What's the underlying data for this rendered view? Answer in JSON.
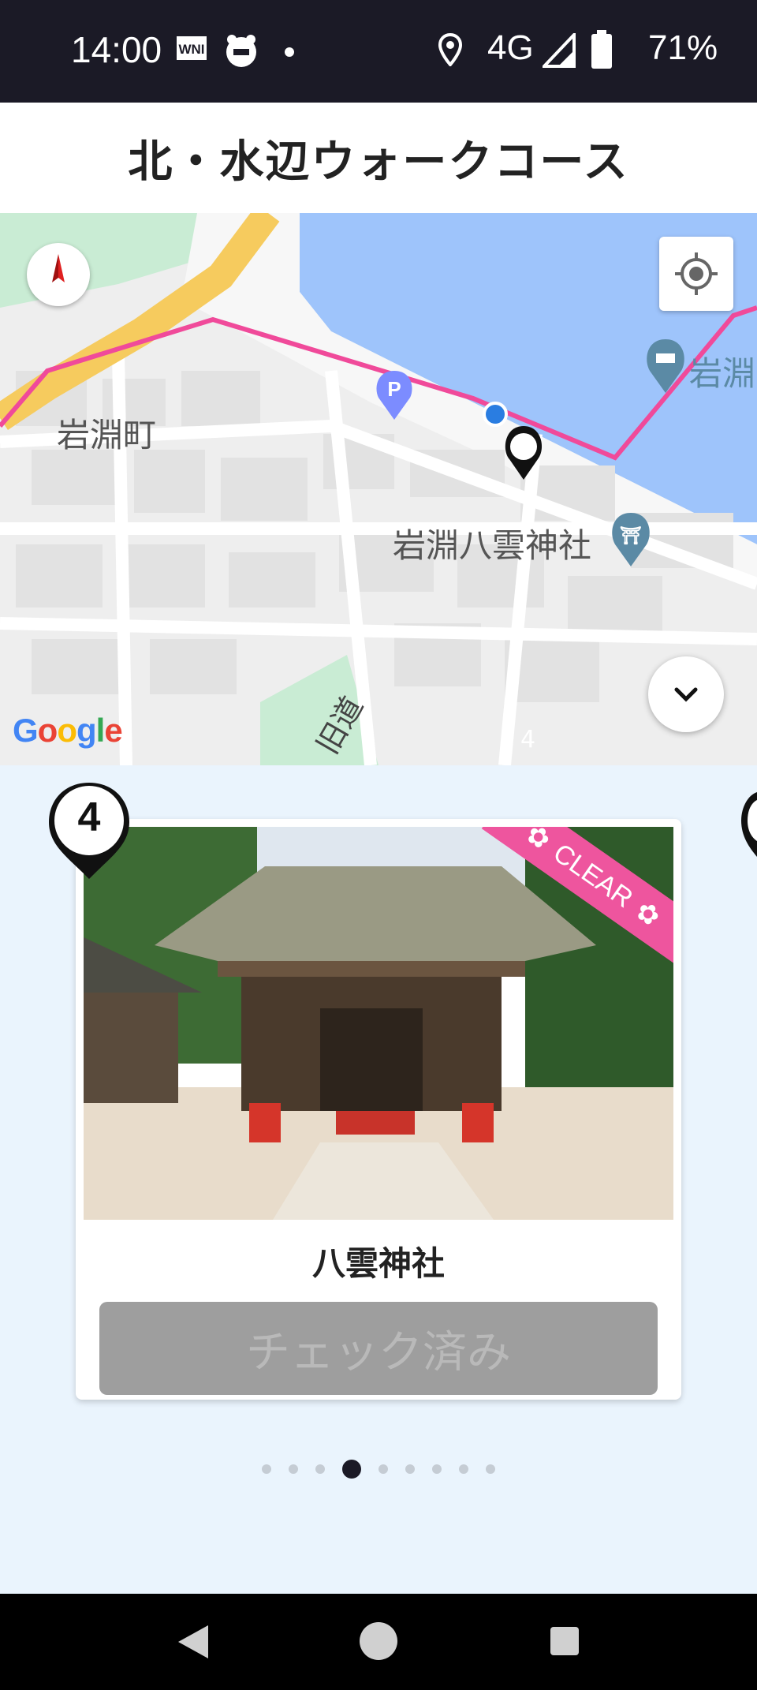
{
  "status_bar": {
    "time": "14:00",
    "network": "4G",
    "battery": "71%",
    "icons": [
      "wni-icon",
      "app-icon",
      "notification-dot-icon",
      "location-icon",
      "signal-icon",
      "battery-icon"
    ]
  },
  "header": {
    "title": "北・水辺ウォークコース"
  },
  "map": {
    "labels": {
      "district": "岩淵町",
      "shrine": "岩淵八雲神社",
      "right_edge": "岩淵",
      "road": "旧道"
    },
    "marker_number": "4",
    "google_logo": "Google",
    "colors": {
      "water": "#9ec4fb",
      "route": "#f04a9a",
      "road": "#f6cb5e",
      "park": "#c9ecd4"
    }
  },
  "card": {
    "number": "4",
    "ribbon": "CLEAR",
    "spot_name": "八雲神社",
    "button_label": "チェック済み"
  },
  "pagination": {
    "total": 9,
    "active_index": 3
  },
  "nav_bar": {
    "icons": [
      "back-icon",
      "home-icon",
      "recents-icon"
    ]
  }
}
